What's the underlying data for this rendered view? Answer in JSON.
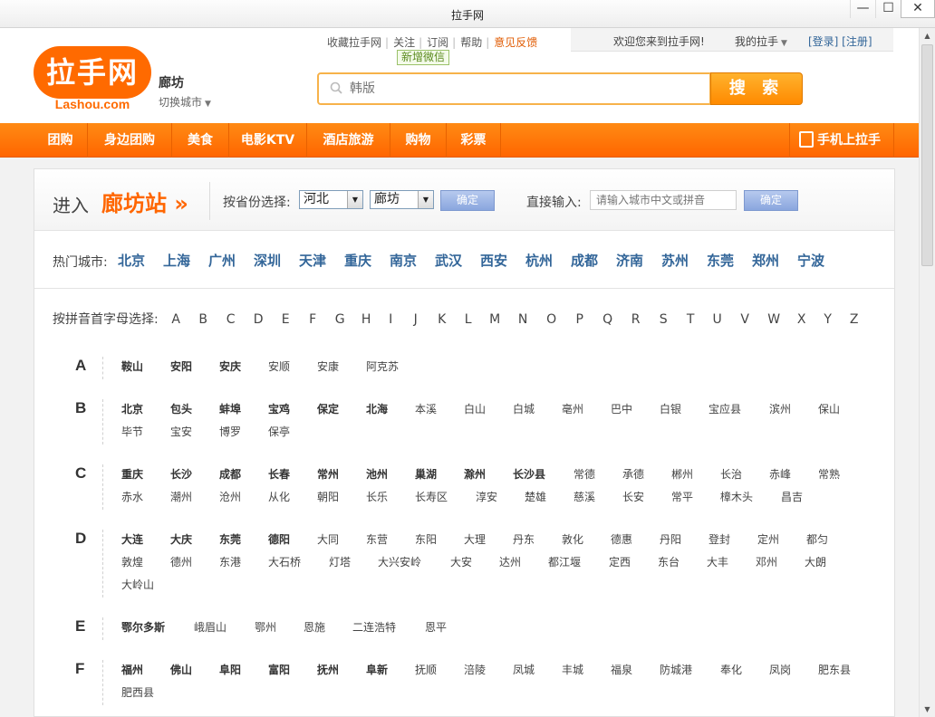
{
  "window": {
    "title": "拉手网",
    "min": "—",
    "max": "☐",
    "close": "✕"
  },
  "header": {
    "logo_text": "拉手网",
    "logo_sub": "Lashou.com",
    "city": "廊坊",
    "switch_city": "切换城市",
    "toplinks": [
      "收藏拉手网",
      "关注",
      "订阅",
      "帮助",
      "意见反馈"
    ],
    "wechat_tag": "新增微信",
    "welcome": "欢迎您来到拉手网!",
    "my_lashou": "我的拉手",
    "login_register": "[登录] [注册]",
    "search_placeholder": "韩版",
    "search_button": "搜 索"
  },
  "nav": {
    "items": [
      "团购",
      "身边团购",
      "美食",
      "电影KTV",
      "酒店旅游",
      "购物",
      "彩票"
    ],
    "mobile": "手机上拉手",
    "mobile_icon": "phone-icon"
  },
  "city_select": {
    "enter": "进入",
    "station": "廊坊站 »",
    "province_label": "按省份选择:",
    "province": "河北",
    "city": "廊坊",
    "confirm": "确定",
    "direct_label": "直接输入:",
    "direct_placeholder": "请输入城市中文或拼音",
    "confirm2": "确定",
    "hot_label": "热门城市:",
    "hot_cities": [
      "北京",
      "上海",
      "广州",
      "深圳",
      "天津",
      "重庆",
      "南京",
      "武汉",
      "西安",
      "杭州",
      "成都",
      "济南",
      "苏州",
      "东莞",
      "郑州",
      "宁波"
    ],
    "letter_label": "按拼音首字母选择:",
    "letters": [
      "A",
      "B",
      "C",
      "D",
      "E",
      "F",
      "G",
      "H",
      "I",
      "J",
      "K",
      "L",
      "M",
      "N",
      "O",
      "P",
      "Q",
      "R",
      "S",
      "T",
      "U",
      "V",
      "W",
      "X",
      "Y",
      "Z"
    ]
  },
  "groups": [
    {
      "letter": "A",
      "rows": [
        [
          [
            "鞍山",
            1
          ],
          [
            "安阳",
            1
          ],
          [
            "安庆",
            1
          ],
          [
            "安顺",
            0
          ],
          [
            "安康",
            0
          ],
          [
            "阿克苏",
            0
          ]
        ]
      ]
    },
    {
      "letter": "B",
      "rows": [
        [
          [
            "北京",
            1
          ],
          [
            "包头",
            1
          ],
          [
            "蚌埠",
            1
          ],
          [
            "宝鸡",
            1
          ],
          [
            "保定",
            1
          ],
          [
            "北海",
            1
          ],
          [
            "本溪",
            0
          ],
          [
            "白山",
            0
          ],
          [
            "白城",
            0
          ],
          [
            "亳州",
            0
          ],
          [
            "巴中",
            0
          ],
          [
            "白银",
            0
          ],
          [
            "宝应县",
            0
          ],
          [
            "滨州",
            0
          ],
          [
            "保山",
            0
          ]
        ],
        [
          [
            "毕节",
            0
          ],
          [
            "宝安",
            0
          ],
          [
            "博罗",
            0
          ],
          [
            "保亭",
            0
          ]
        ]
      ]
    },
    {
      "letter": "C",
      "rows": [
        [
          [
            "重庆",
            1
          ],
          [
            "长沙",
            1
          ],
          [
            "成都",
            1
          ],
          [
            "长春",
            1
          ],
          [
            "常州",
            1
          ],
          [
            "池州",
            1
          ],
          [
            "巢湖",
            1
          ],
          [
            "滁州",
            1
          ],
          [
            "长沙县",
            1
          ],
          [
            "常德",
            0
          ],
          [
            "承德",
            0
          ],
          [
            "郴州",
            0
          ],
          [
            "长治",
            0
          ],
          [
            "赤峰",
            0
          ],
          [
            "常熟",
            0
          ]
        ],
        [
          [
            "赤水",
            0
          ],
          [
            "潮州",
            0
          ],
          [
            "沧州",
            0
          ],
          [
            "从化",
            0
          ],
          [
            "朝阳",
            0
          ],
          [
            "长乐",
            0
          ],
          [
            "长寿区",
            0
          ],
          [
            "淳安",
            0
          ],
          [
            "楚雄",
            0
          ],
          [
            "慈溪",
            0
          ],
          [
            "长安",
            0
          ],
          [
            "常平",
            0
          ],
          [
            "樟木头",
            0
          ],
          [
            "昌吉",
            0
          ]
        ]
      ]
    },
    {
      "letter": "D",
      "rows": [
        [
          [
            "大连",
            1
          ],
          [
            "大庆",
            1
          ],
          [
            "东莞",
            1
          ],
          [
            "德阳",
            1
          ],
          [
            "大同",
            0
          ],
          [
            "东营",
            0
          ],
          [
            "东阳",
            0
          ],
          [
            "大理",
            0
          ],
          [
            "丹东",
            0
          ],
          [
            "敦化",
            0
          ],
          [
            "德惠",
            0
          ],
          [
            "丹阳",
            0
          ],
          [
            "登封",
            0
          ],
          [
            "定州",
            0
          ],
          [
            "都匀",
            0
          ]
        ],
        [
          [
            "敦煌",
            0
          ],
          [
            "德州",
            0
          ],
          [
            "东港",
            0
          ],
          [
            "大石桥",
            0
          ],
          [
            "灯塔",
            0
          ],
          [
            "大兴安岭",
            0
          ],
          [
            "大安",
            0
          ],
          [
            "达州",
            0
          ],
          [
            "都江堰",
            0
          ],
          [
            "定西",
            0
          ],
          [
            "东台",
            0
          ],
          [
            "大丰",
            0
          ],
          [
            "邓州",
            0
          ],
          [
            "大朗",
            0
          ]
        ],
        [
          [
            "大岭山",
            0
          ]
        ]
      ]
    },
    {
      "letter": "E",
      "rows": [
        [
          [
            "鄂尔多斯",
            1
          ],
          [
            "峨眉山",
            0
          ],
          [
            "鄂州",
            0
          ],
          [
            "恩施",
            0
          ],
          [
            "二连浩特",
            0
          ],
          [
            "恩平",
            0
          ]
        ]
      ]
    },
    {
      "letter": "F",
      "rows": [
        [
          [
            "福州",
            1
          ],
          [
            "佛山",
            1
          ],
          [
            "阜阳",
            1
          ],
          [
            "富阳",
            1
          ],
          [
            "抚州",
            1
          ],
          [
            "阜新",
            1
          ],
          [
            "抚顺",
            0
          ],
          [
            "涪陵",
            0
          ],
          [
            "凤城",
            0
          ],
          [
            "丰城",
            0
          ],
          [
            "福泉",
            0
          ],
          [
            "防城港",
            0
          ],
          [
            "奉化",
            0
          ],
          [
            "凤岗",
            0
          ],
          [
            "肥东县",
            0
          ]
        ],
        [
          [
            "肥西县",
            0
          ]
        ]
      ]
    }
  ]
}
